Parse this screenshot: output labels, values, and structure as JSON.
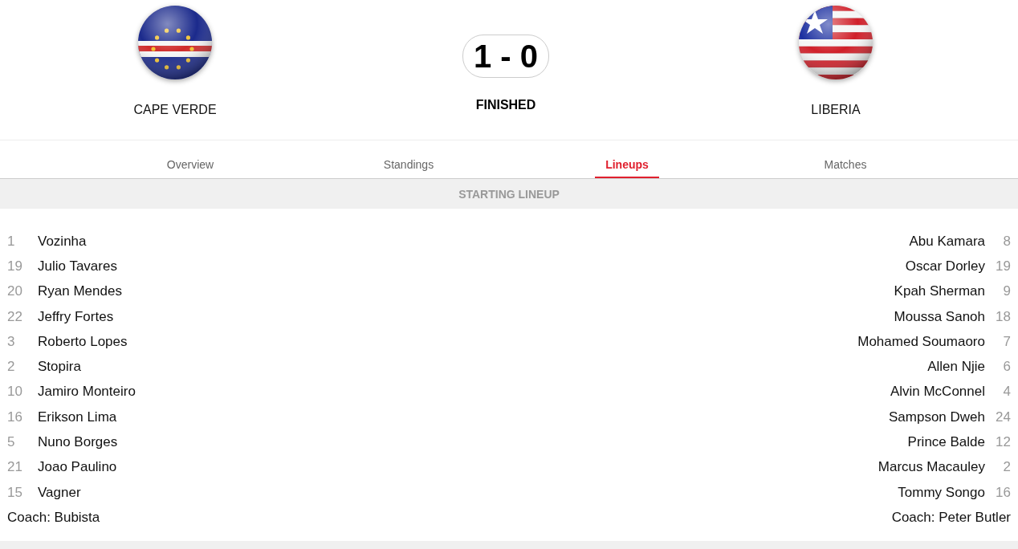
{
  "match": {
    "home": {
      "name": "CAPE VERDE"
    },
    "score": "1 - 0",
    "status": "FINISHED",
    "away": {
      "name": "LIBERIA"
    }
  },
  "tabs": [
    {
      "label": "Overview",
      "selected": false
    },
    {
      "label": "Standings",
      "selected": false
    },
    {
      "label": "Lineups",
      "selected": true
    },
    {
      "label": "Matches",
      "selected": false
    }
  ],
  "section_title": "STARTING LINEUP",
  "home_lineup": {
    "players": [
      {
        "number": "1",
        "name": "Vozinha"
      },
      {
        "number": "19",
        "name": "Julio Tavares"
      },
      {
        "number": "20",
        "name": "Ryan Mendes"
      },
      {
        "number": "22",
        "name": "Jeffry Fortes"
      },
      {
        "number": "3",
        "name": "Roberto Lopes"
      },
      {
        "number": "2",
        "name": "Stopira"
      },
      {
        "number": "10",
        "name": "Jamiro Monteiro"
      },
      {
        "number": "16",
        "name": "Erikson Lima"
      },
      {
        "number": "5",
        "name": "Nuno Borges"
      },
      {
        "number": "21",
        "name": "Joao Paulino"
      },
      {
        "number": "15",
        "name": "Vagner"
      }
    ],
    "coach": "Coach: Bubista"
  },
  "away_lineup": {
    "players": [
      {
        "number": "8",
        "name": "Abu Kamara"
      },
      {
        "number": "19",
        "name": "Oscar Dorley"
      },
      {
        "number": "9",
        "name": "Kpah Sherman"
      },
      {
        "number": "18",
        "name": "Moussa Sanoh"
      },
      {
        "number": "7",
        "name": "Mohamed Soumaoro"
      },
      {
        "number": "6",
        "name": "Allen Njie"
      },
      {
        "number": "4",
        "name": "Alvin McConnel"
      },
      {
        "number": "24",
        "name": "Sampson Dweh"
      },
      {
        "number": "12",
        "name": "Prince Balde"
      },
      {
        "number": "2",
        "name": "Marcus Macauley"
      },
      {
        "number": "16",
        "name": "Tommy Songo"
      }
    ],
    "coach": "Coach: Peter Butler"
  }
}
